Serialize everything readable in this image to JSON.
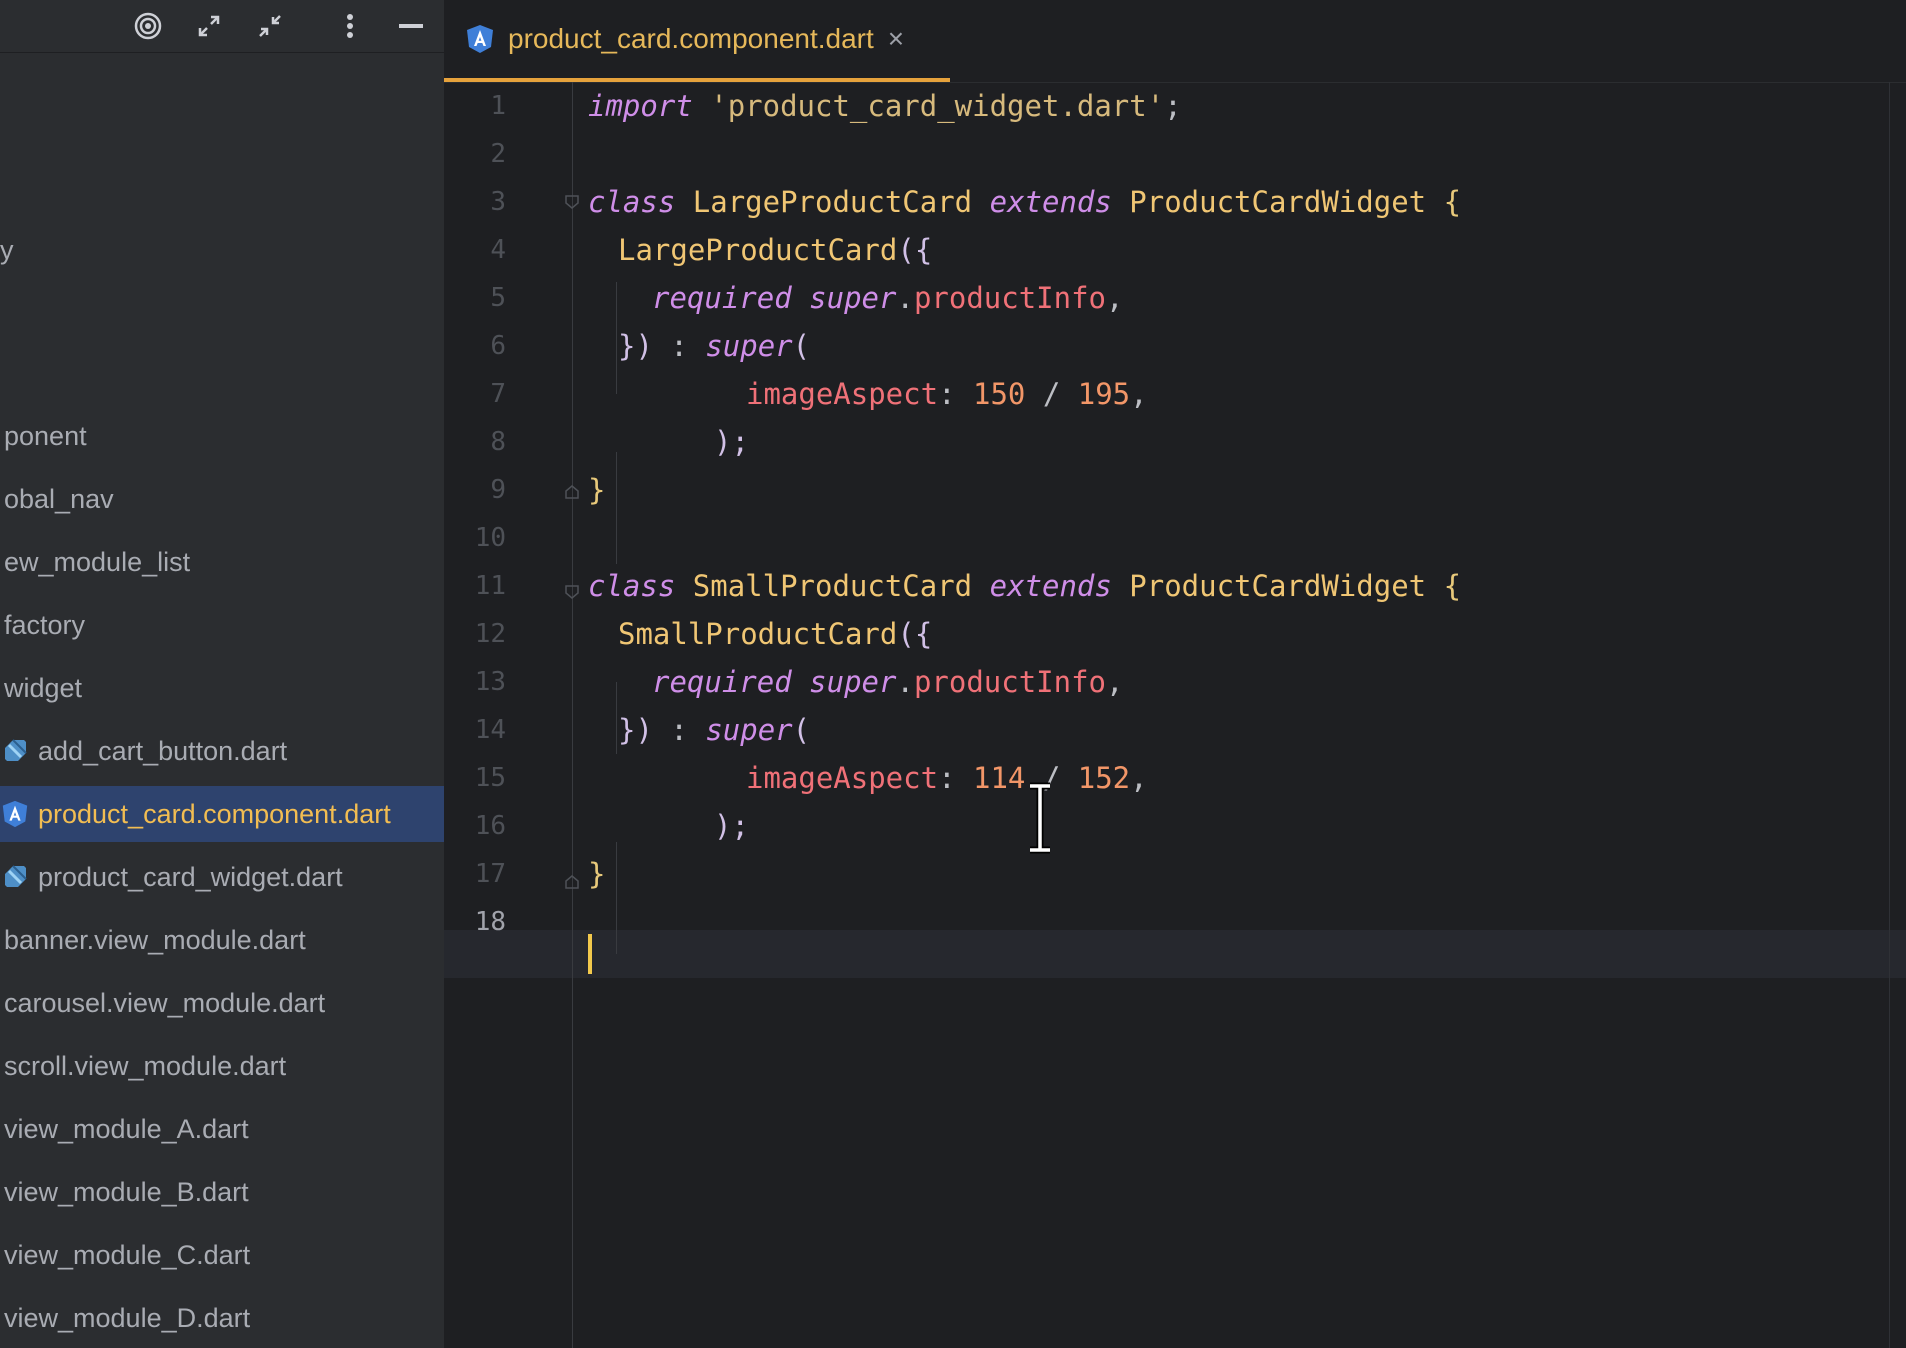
{
  "sidebar": {
    "toolbar": {
      "icons": [
        "target-icon",
        "expand-icon",
        "collapse-icon",
        "more-vert-icon",
        "minimize-icon"
      ]
    },
    "items": [
      {
        "label": "y",
        "icon": ""
      },
      {
        "label": "ponent",
        "icon": ""
      },
      {
        "label": "obal_nav",
        "icon": ""
      },
      {
        "label": "ew_module_list",
        "icon": ""
      },
      {
        "label": "factory",
        "icon": ""
      },
      {
        "label": "widget",
        "icon": ""
      },
      {
        "label": "add_cart_button.dart",
        "icon": "dart-icon"
      },
      {
        "label": "product_card.component.dart",
        "icon": "angular-icon",
        "selected": true
      },
      {
        "label": "product_card_widget.dart",
        "icon": "dart-icon"
      },
      {
        "label": "banner.view_module.dart",
        "icon": ""
      },
      {
        "label": "carousel.view_module.dart",
        "icon": ""
      },
      {
        "label": "scroll.view_module.dart",
        "icon": ""
      },
      {
        "label": "view_module_A.dart",
        "icon": ""
      },
      {
        "label": "view_module_B.dart",
        "icon": ""
      },
      {
        "label": "view_module_C.dart",
        "icon": ""
      },
      {
        "label": "view_module_D.dart",
        "icon": ""
      }
    ]
  },
  "editor": {
    "tab": {
      "label": "product_card.component.dart",
      "close": "×"
    },
    "current_line": 18,
    "line_numbers": [
      "1",
      "2",
      "3",
      "4",
      "5",
      "6",
      "7",
      "8",
      "9",
      "10",
      "11",
      "12",
      "13",
      "14",
      "15",
      "16",
      "17",
      "18"
    ],
    "code": {
      "l1": {
        "kw": "import",
        "str": "'product_card_widget.dart'",
        "end": ";"
      },
      "l3": {
        "kw1": "class",
        "name": "LargeProductCard",
        "kw2": "extends",
        "parent": "ProductCardWidget",
        "brace": "{"
      },
      "l4": {
        "name": "LargeProductCard",
        "open": "({"
      },
      "l5": {
        "kw1": "required",
        "kw2": "super",
        "dot": ".",
        "field": "productInfo",
        "comma": ","
      },
      "l6": {
        "close": "})",
        "colon": " : ",
        "kw": "super",
        "open": "("
      },
      "l7": {
        "param": "imageAspect",
        "colon": ": ",
        "n1": "150",
        "op": " / ",
        "n2": "195",
        "comma": ","
      },
      "l8": {
        "close": ");"
      },
      "l9": {
        "brace": "}"
      },
      "l11": {
        "kw1": "class",
        "name": "SmallProductCard",
        "kw2": "extends",
        "parent": "ProductCardWidget",
        "brace": "{"
      },
      "l12": {
        "name": "SmallProductCard",
        "open": "({"
      },
      "l13": {
        "kw1": "required",
        "kw2": "super",
        "dot": ".",
        "field": "productInfo",
        "comma": ","
      },
      "l14": {
        "close": "})",
        "colon": " : ",
        "kw": "super",
        "open": "("
      },
      "l15": {
        "param": "imageAspect",
        "colon": ": ",
        "n1": "114",
        "op": " / ",
        "n2": "152",
        "comma": ","
      },
      "l16": {
        "close": ");"
      },
      "l17": {
        "brace": "}"
      }
    }
  },
  "colors": {
    "accent": "#e6a23c",
    "selection": "#2e436e",
    "keyword": "#cf8ee8",
    "class": "#f0c674",
    "number": "#f29668"
  }
}
